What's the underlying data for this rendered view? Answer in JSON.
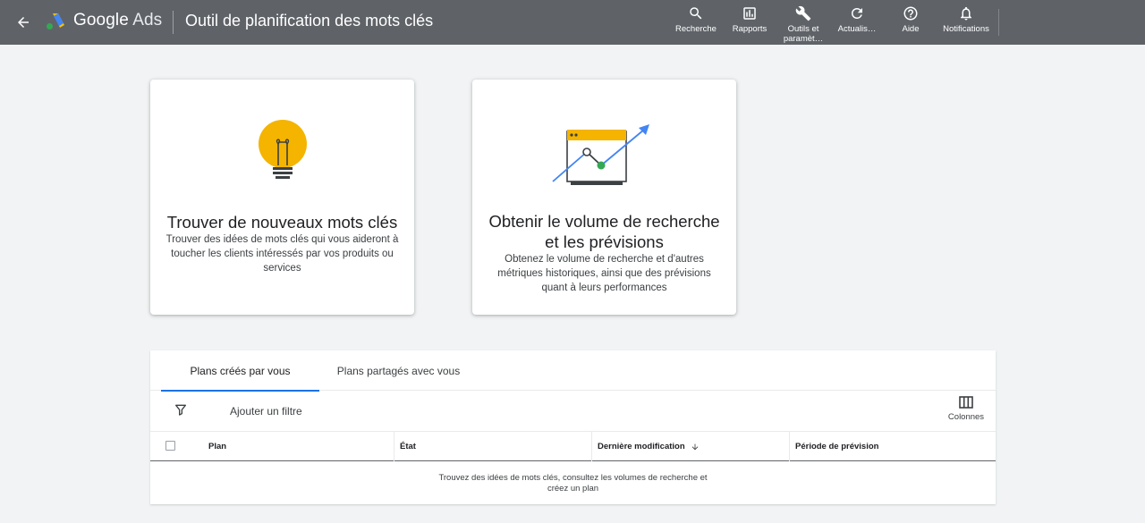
{
  "header": {
    "brand_google": "Google",
    "brand_ads": "Ads",
    "title": "Outil de planification des mots clés",
    "tools": [
      {
        "label": "Recherche",
        "icon": "search-icon"
      },
      {
        "label": "Rapports",
        "icon": "reports-icon"
      },
      {
        "label": "Outils et paramèt…",
        "icon": "wrench-icon"
      },
      {
        "label": "Actualis…",
        "icon": "refresh-icon"
      },
      {
        "label": "Aide",
        "icon": "help-icon"
      },
      {
        "label": "Notifications",
        "icon": "bell-icon"
      }
    ]
  },
  "cards": {
    "discover": {
      "title": "Trouver de nouveaux mots clés",
      "description": "Trouver des idées de mots clés qui vous aideront à toucher les clients intéressés par vos produits ou services",
      "icon": "lightbulb-icon"
    },
    "forecast": {
      "title": "Obtenir le volume de recherche et les prévisions",
      "description": "Obtenez le volume de recherche et d'autres métriques historiques, ainsi que des prévisions quant à leurs performances",
      "icon": "trend-chart-icon"
    }
  },
  "plans": {
    "tabs": [
      "Plans créés par vous",
      "Plans partagés avec vous"
    ],
    "active_tab": 0,
    "filter_label": "Ajouter un filtre",
    "columns_label": "Colonnes",
    "table_headers": [
      "Plan",
      "État",
      "Dernière modification",
      "Période de prévision"
    ],
    "sort_column": "Dernière modification",
    "empty_message_line1": "Trouvez des idées de mots clés, consultez les volumes de recherche et",
    "empty_message_line2": "créez un plan"
  },
  "colors": {
    "topbar": "#5f6368",
    "accent": "#1a73e8",
    "lightbulb": "#f4b400",
    "trend_green": "#34a853",
    "trend_blue": "#4285f4"
  }
}
